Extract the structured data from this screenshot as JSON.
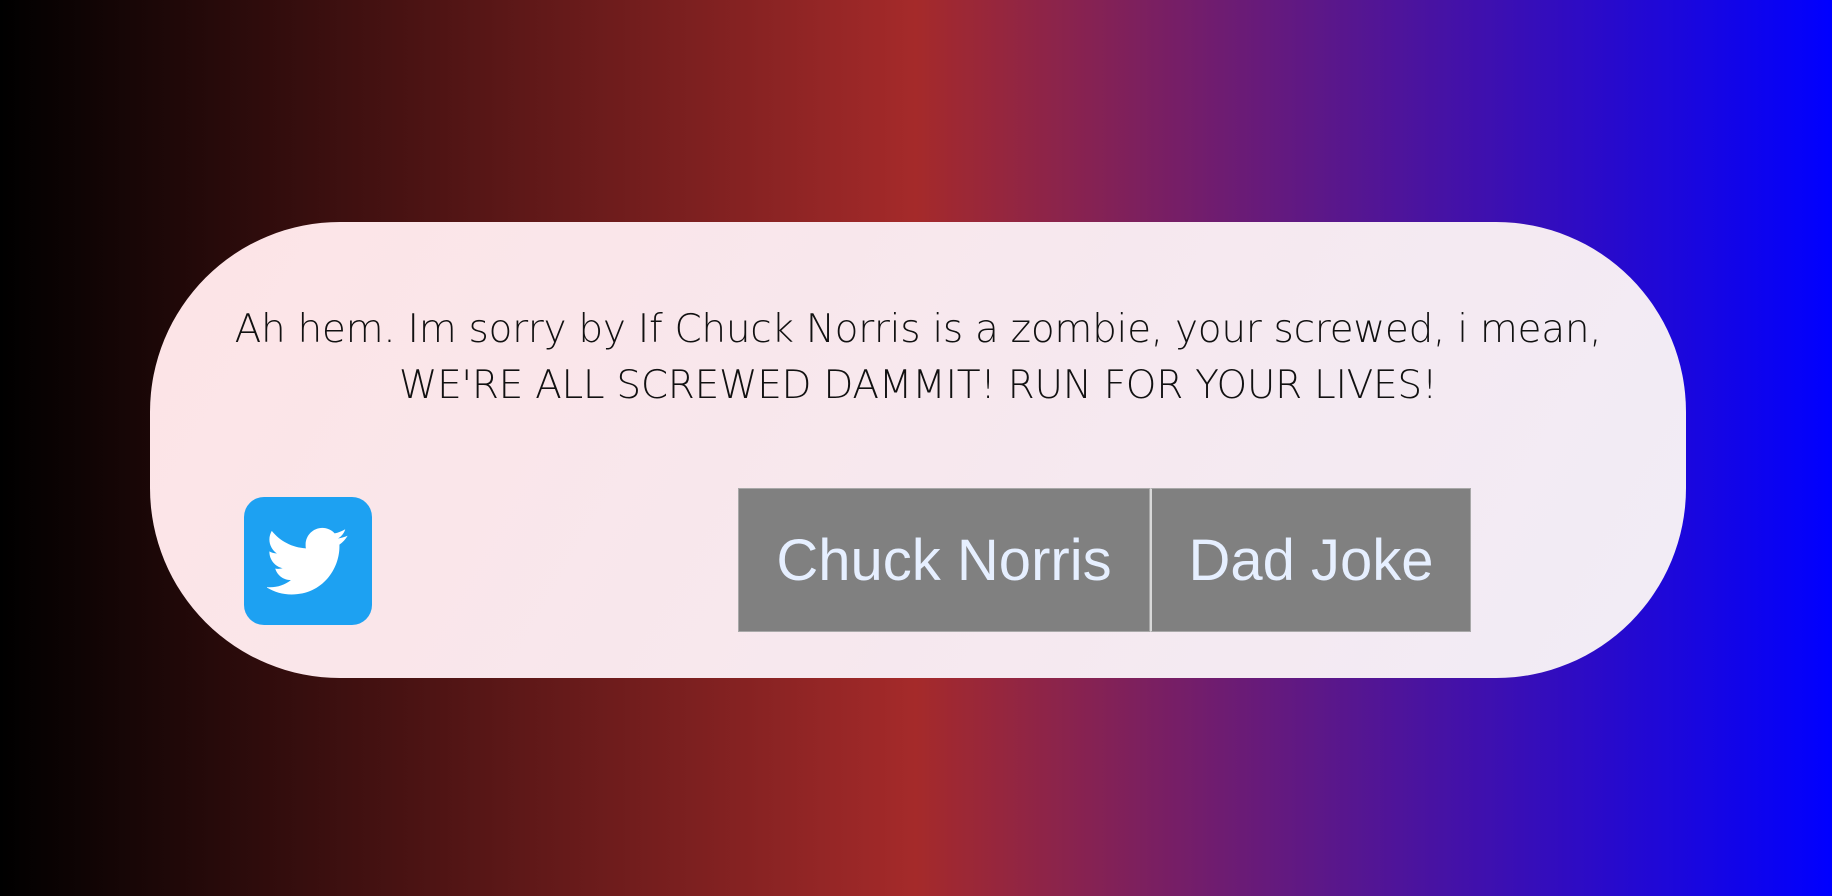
{
  "joke": {
    "text": "Ah hem. Im sorry by If Chuck Norris is a zombie, your screwed, i mean, WE'RE ALL SCREWED DAMMIT! RUN FOR YOUR LIVES!"
  },
  "actions": {
    "chuck_label": "Chuck Norris",
    "dad_label": "Dad Joke",
    "share_icon": "twitter-icon"
  },
  "colors": {
    "gradient_left": "#000000",
    "gradient_mid": "#a52a2a",
    "gradient_right": "#0000ff",
    "twitter_blue": "#1da1f2",
    "button_gray": "#808080"
  }
}
